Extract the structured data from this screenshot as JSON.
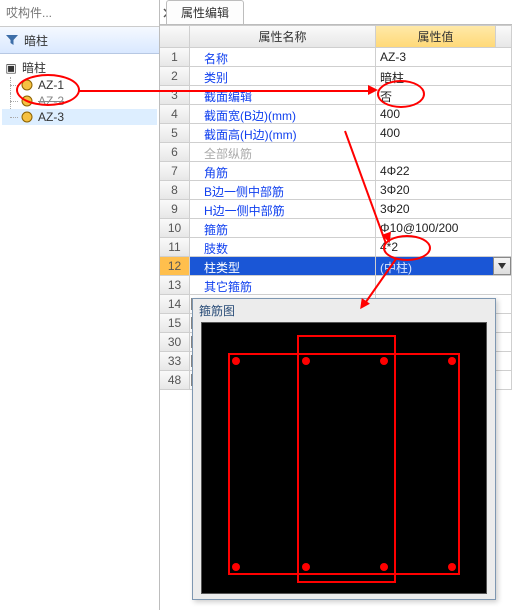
{
  "search": {
    "placeholder": "哎构件..."
  },
  "filter": {
    "label": "暗柱"
  },
  "tree": {
    "root": "暗柱",
    "items": [
      {
        "label": "AZ-1",
        "state": "normal"
      },
      {
        "label": "AZ-2",
        "state": "strike"
      },
      {
        "label": "AZ-3",
        "state": "selected"
      }
    ]
  },
  "tab": {
    "title": "属性编辑"
  },
  "grid": {
    "headers": {
      "name": "属性名称",
      "value": "属性值"
    },
    "rows": [
      {
        "idx": "1",
        "name": "名称",
        "value": "AZ-3"
      },
      {
        "idx": "2",
        "name": "类别",
        "value": "暗柱"
      },
      {
        "idx": "3",
        "name": "截面编辑",
        "value": "否"
      },
      {
        "idx": "4",
        "name": "截面宽(B边)(mm)",
        "value": "400"
      },
      {
        "idx": "5",
        "name": "截面高(H边)(mm)",
        "value": "400"
      },
      {
        "idx": "6",
        "name": "全部纵筋",
        "value": "",
        "muted": true
      },
      {
        "idx": "7",
        "name": "角筋",
        "value": "4Φ22"
      },
      {
        "idx": "8",
        "name": "B边一侧中部筋",
        "value": "3Φ20"
      },
      {
        "idx": "9",
        "name": "H边一侧中部筋",
        "value": "3Φ20"
      },
      {
        "idx": "10",
        "name": "箍筋",
        "value": "Φ10@100/200"
      },
      {
        "idx": "11",
        "name": "肢数",
        "value": "4*2"
      },
      {
        "idx": "12",
        "name": "柱类型",
        "value": "(中柱)",
        "selected": true,
        "dropdown": true
      },
      {
        "idx": "13",
        "name": "其它箍筋",
        "value": ""
      }
    ],
    "collapsed": [
      "14",
      "15",
      "30",
      "33",
      "48"
    ]
  },
  "floater": {
    "title": "箍筋图"
  }
}
